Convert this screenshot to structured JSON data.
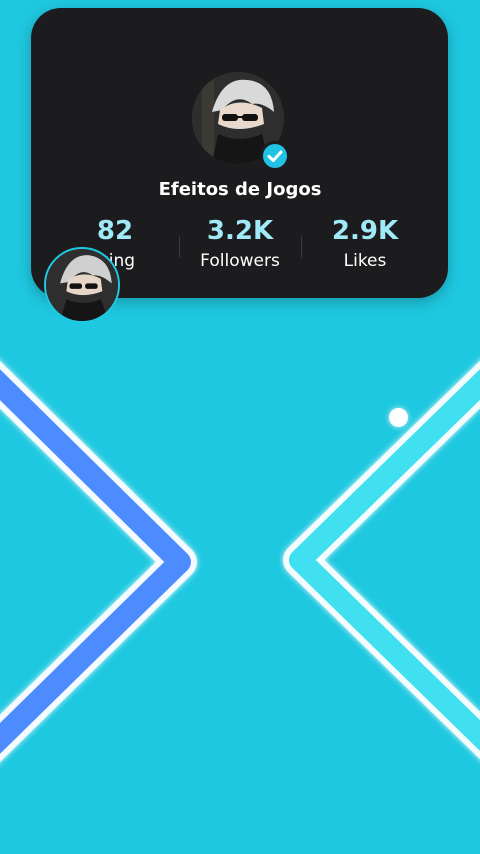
{
  "profile": {
    "name": "Efeitos de Jogos",
    "verified": true,
    "avatar_icon": "anime-character-avatar-icon"
  },
  "stats": {
    "following": {
      "value": "82",
      "label": "wing"
    },
    "followers": {
      "value": "3.2K",
      "label": "Followers"
    },
    "likes": {
      "value": "2.9K",
      "label": "Likes"
    }
  },
  "game": {
    "background_color": "#1ec8e0",
    "left_wall_color": "#4d8cff",
    "right_wall_color": "#3fe0f0",
    "ball_color": "#ffffff"
  }
}
